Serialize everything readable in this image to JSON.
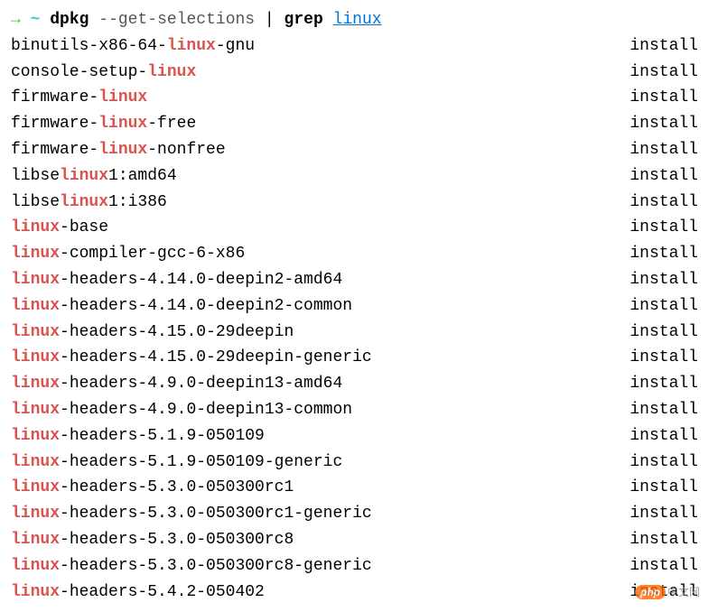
{
  "prompt": {
    "arrow": "→",
    "tilde": "~",
    "cmd1": "dpkg",
    "option": "--get-selections",
    "pipe": "|",
    "cmd2": "grep",
    "arg": "linux"
  },
  "highlight_term": "linux",
  "packages": [
    {
      "prefix": "binutils-x86-64-",
      "match": "linux",
      "suffix": "-gnu",
      "status": "install"
    },
    {
      "prefix": "console-setup-",
      "match": "linux",
      "suffix": "",
      "status": "install"
    },
    {
      "prefix": "firmware-",
      "match": "linux",
      "suffix": "",
      "status": "install"
    },
    {
      "prefix": "firmware-",
      "match": "linux",
      "suffix": "-free",
      "status": "install"
    },
    {
      "prefix": "firmware-",
      "match": "linux",
      "suffix": "-nonfree",
      "status": "install"
    },
    {
      "prefix": "libse",
      "match": "linux",
      "suffix": "1:amd64",
      "status": "install"
    },
    {
      "prefix": "libse",
      "match": "linux",
      "suffix": "1:i386",
      "status": "install"
    },
    {
      "prefix": "",
      "match": "linux",
      "suffix": "-base",
      "status": "install"
    },
    {
      "prefix": "",
      "match": "linux",
      "suffix": "-compiler-gcc-6-x86",
      "status": "install"
    },
    {
      "prefix": "",
      "match": "linux",
      "suffix": "-headers-4.14.0-deepin2-amd64",
      "status": "install"
    },
    {
      "prefix": "",
      "match": "linux",
      "suffix": "-headers-4.14.0-deepin2-common",
      "status": "install"
    },
    {
      "prefix": "",
      "match": "linux",
      "suffix": "-headers-4.15.0-29deepin",
      "status": "install"
    },
    {
      "prefix": "",
      "match": "linux",
      "suffix": "-headers-4.15.0-29deepin-generic",
      "status": "install"
    },
    {
      "prefix": "",
      "match": "linux",
      "suffix": "-headers-4.9.0-deepin13-amd64",
      "status": "install"
    },
    {
      "prefix": "",
      "match": "linux",
      "suffix": "-headers-4.9.0-deepin13-common",
      "status": "install"
    },
    {
      "prefix": "",
      "match": "linux",
      "suffix": "-headers-5.1.9-050109",
      "status": "install"
    },
    {
      "prefix": "",
      "match": "linux",
      "suffix": "-headers-5.1.9-050109-generic",
      "status": "install"
    },
    {
      "prefix": "",
      "match": "linux",
      "suffix": "-headers-5.3.0-050300rc1",
      "status": "install"
    },
    {
      "prefix": "",
      "match": "linux",
      "suffix": "-headers-5.3.0-050300rc1-generic",
      "status": "install"
    },
    {
      "prefix": "",
      "match": "linux",
      "suffix": "-headers-5.3.0-050300rc8",
      "status": "install"
    },
    {
      "prefix": "",
      "match": "linux",
      "suffix": "-headers-5.3.0-050300rc8-generic",
      "status": "install"
    },
    {
      "prefix": "",
      "match": "linux",
      "suffix": "-headers-5.4.2-050402",
      "status": "install"
    }
  ],
  "watermark": {
    "badge": "php",
    "text": "中文网"
  }
}
